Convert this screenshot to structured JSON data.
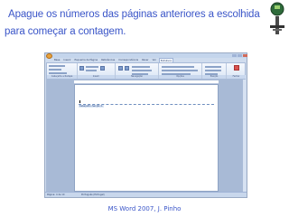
{
  "slide": {
    "line1": "Apague os números das páginas anteriores a escolhida",
    "line2": "para começar a contagem.",
    "footer": "MS Word 2007, J. Pinho"
  },
  "word": {
    "tabs": [
      "Base",
      "Inserir",
      "Esquema de Página",
      "Referências",
      "Correspondência",
      "Rever",
      "Ver",
      "Estrutura"
    ],
    "active_tab_index": 7,
    "groups": [
      "Cabeçalho e Rodapé",
      "Inserir",
      "Navegação",
      "Opções",
      "Posição",
      "Fechar"
    ],
    "header_label": "Cabeçalho -Secção 2-",
    "status_page": "Página: 4 de 10",
    "status_lang": "Português (Portugal)"
  },
  "colors": {
    "title_text": "#3a55c8",
    "ribbon_bg": "#dbe6f5",
    "page_area_bg": "#a8bad6"
  }
}
